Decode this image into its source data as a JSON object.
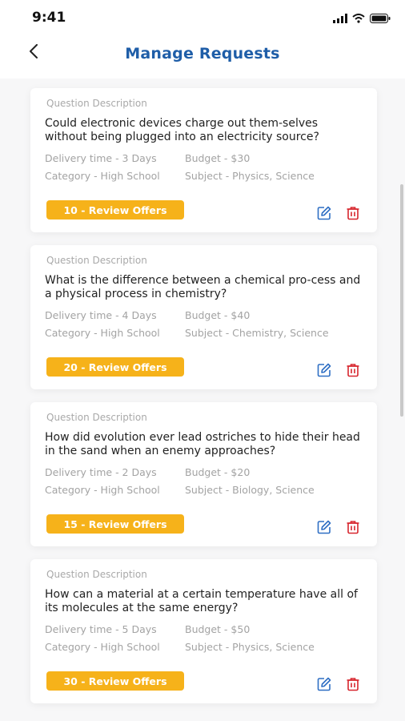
{
  "status_bar": {
    "time": "9:41"
  },
  "header": {
    "title": "Manage Requests"
  },
  "requests": [
    {
      "desc_label": "Question Description",
      "question": "Could electronic devices charge out them-selves without being plugged into an electricity source?",
      "delivery": "Delivery time - 3 Days",
      "budget": "Budget - $30",
      "category": "Category - High School",
      "subject": "Subject - Physics, Science",
      "review_label": "10 - Review Offers"
    },
    {
      "desc_label": "Question Description",
      "question": "What is the difference between a chemical pro-cess and a physical process in chemistry?",
      "delivery": "Delivery time - 4 Days",
      "budget": "Budget - $40",
      "category": "Category - High School",
      "subject": "Subject - Chemistry, Science",
      "review_label": "20 - Review Offers"
    },
    {
      "desc_label": "Question Description",
      "question": "How did evolution ever lead ostriches to hide their head in the sand when an enemy approaches?",
      "delivery": "Delivery time - 2 Days",
      "budget": "Budget - $20",
      "category": "Category - High School",
      "subject": "Subject - Biology, Science",
      "review_label": "15 - Review Offers"
    },
    {
      "desc_label": "Question Description",
      "question": "How can a material at a certain temperature have all of its molecules at the same energy?",
      "delivery": "Delivery time - 5 Days",
      "budget": "Budget - $50",
      "category": "Category - High School",
      "subject": "Subject - Physics, Science",
      "review_label": "30 - Review Offers"
    }
  ],
  "colors": {
    "title": "#1f5ea8",
    "accent": "#f6b21a",
    "edit_icon": "#2f6fc4",
    "delete_icon": "#d7262e"
  },
  "icons": {
    "back": "chevron-left-icon",
    "edit": "edit-icon",
    "delete": "trash-icon",
    "signal": "signal-icon",
    "wifi": "wifi-icon",
    "battery": "battery-icon"
  }
}
